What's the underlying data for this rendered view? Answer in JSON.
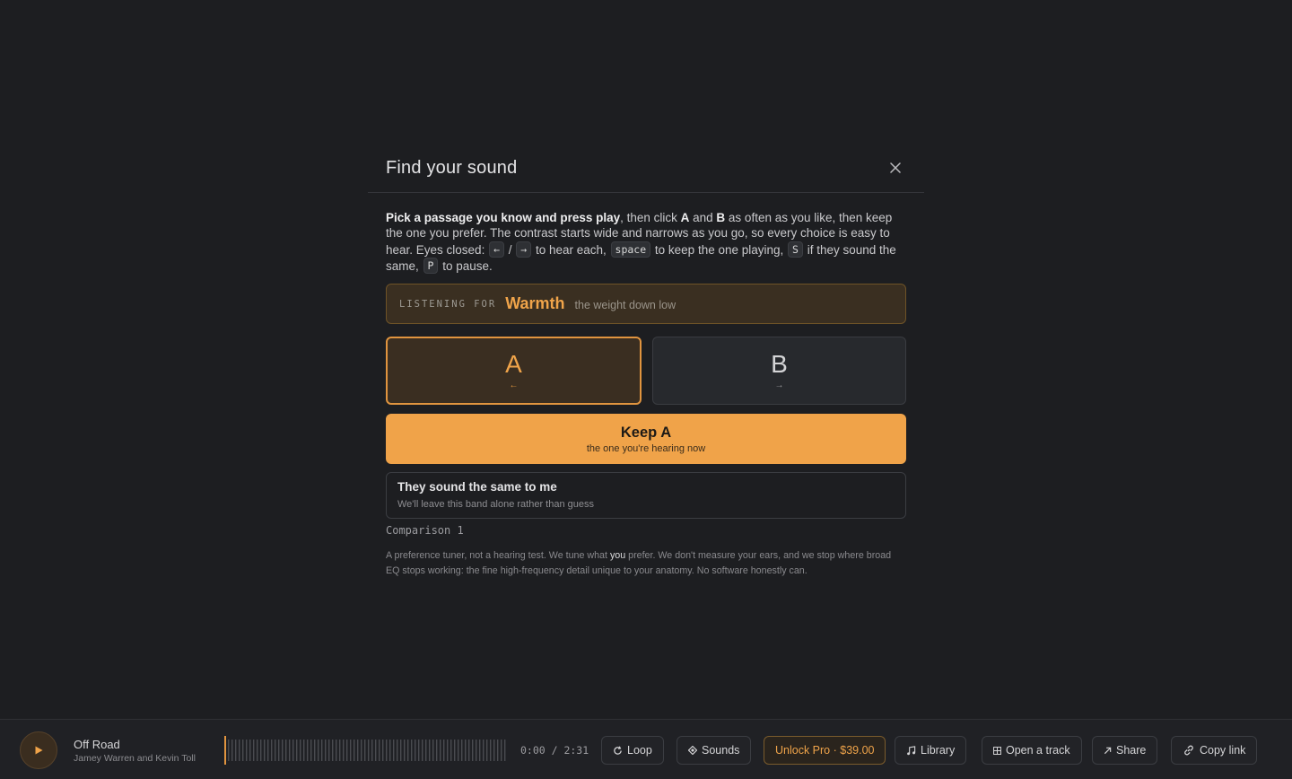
{
  "dialog": {
    "title": "Find your sound",
    "intro": {
      "bold_lead": "Pick a passage you know and press play",
      "t1": ", then click ",
      "a": "A",
      "t2": " and ",
      "b": "B",
      "t3": " as often as you like, then keep the one you prefer. The contrast starts wide and narrows as you go, so every choice is easy to hear. Eyes closed: ",
      "key_left": "←",
      "slash": " / ",
      "key_right": "→",
      "t4": " to hear each, ",
      "key_space": "space",
      "t5": " to keep the one playing, ",
      "key_s": "S",
      "t6": " if they sound the same, ",
      "key_p": "P",
      "t7": " to pause."
    },
    "listening": {
      "label": "LISTENING FOR",
      "word": "Warmth",
      "sub": "the weight down low"
    },
    "options": [
      {
        "letter": "A",
        "arrow": "←",
        "active": true
      },
      {
        "letter": "B",
        "arrow": "→",
        "active": false
      }
    ],
    "keep": {
      "title": "Keep A",
      "sub": "the one you're hearing now"
    },
    "same": {
      "title": "They sound the same to me",
      "sub": "We'll leave this band alone rather than guess"
    },
    "comparison": "Comparison 1",
    "footnote": {
      "p1": "A preference tuner, not a hearing test. We tune what ",
      "you": "you",
      "p2": " prefer. We don't measure your ears, and we stop where broad EQ stops working: the fine high-frequency detail unique to your anatomy. No software honestly can."
    }
  },
  "player": {
    "track_title": "Off Road",
    "track_artist": "Jamey Warren and Kevin Toll",
    "time": "0:00 / 2:31",
    "progress": 0,
    "buttons": {
      "loop": "Loop",
      "sounds": "Sounds",
      "unlock": "Unlock Pro · $39.00",
      "library": "Library",
      "open": "Open a track",
      "share": "Share",
      "copy": "Copy link"
    }
  },
  "colors": {
    "accent": "#f0a349",
    "background": "#1d1e21"
  },
  "icons": [
    "close-icon",
    "play-icon",
    "loop-icon",
    "sounds-icon",
    "music-note-icon",
    "grid-icon",
    "arrow-up-right-icon",
    "link-icon"
  ]
}
